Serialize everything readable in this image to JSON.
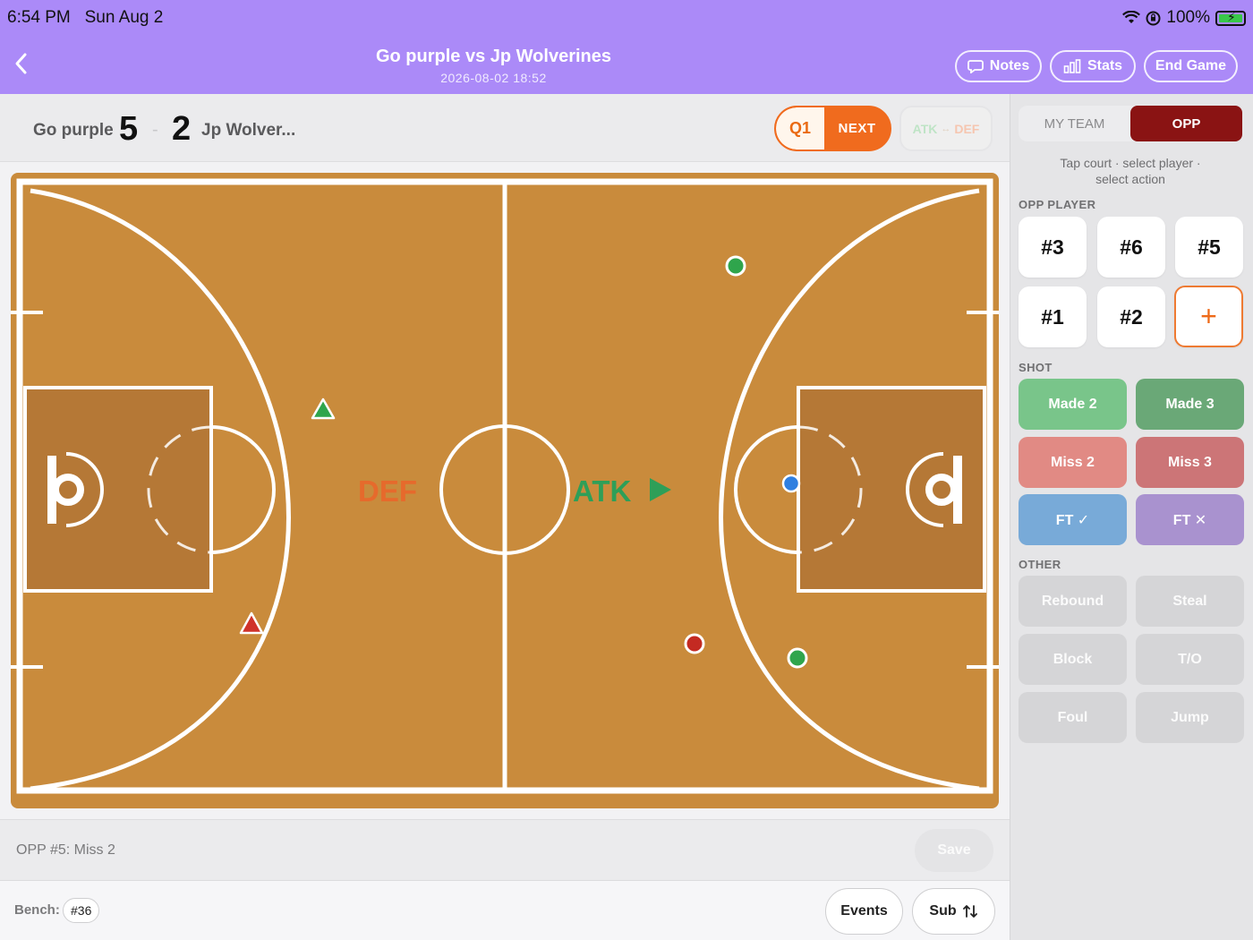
{
  "status": {
    "time": "6:54 PM",
    "date": "Sun Aug 2",
    "battery": "100%"
  },
  "header": {
    "title": "Go purple vs Jp Wolverines",
    "subtitle": "2026-08-02 18:52",
    "buttons": {
      "notes": "Notes",
      "stats": "Stats",
      "end_game": "End Game"
    }
  },
  "scoreboard": {
    "home_name": "Go purple",
    "home_score": "5",
    "separator": "-",
    "away_name": "Jp Wolver...",
    "away_score": "2",
    "quarter": "Q1",
    "next": "NEXT",
    "toggle": {
      "atk": "ATK",
      "arrow": "↔",
      "def": "DEF"
    }
  },
  "court": {
    "def_label": "DEF",
    "atk_label": "ATK",
    "colors": {
      "floor": "#c98b3c",
      "paint": "#b57836",
      "lines": "#ffffff",
      "def": "#e66a2c",
      "atk": "#2e9f58"
    }
  },
  "log": {
    "text": "OPP #5: Miss 2",
    "save": "Save"
  },
  "bench": {
    "label": "Bench:",
    "players": [
      "#36"
    ],
    "events": "Events",
    "sub": "Sub"
  },
  "panel": {
    "tabs": {
      "my_team": "MY TEAM",
      "opp": "OPP"
    },
    "hint_line1": "Tap court · select player ·",
    "hint_line2": "select action",
    "opp_player_label": "OPP PLAYER",
    "players": [
      "#3",
      "#6",
      "#5",
      "#1",
      "#2"
    ],
    "add": "+",
    "shot_label": "SHOT",
    "shots": {
      "made2": "Made 2",
      "made3": "Made 3",
      "miss2": "Miss 2",
      "miss3": "Miss 3",
      "ft_made": "FT ✓",
      "ft_miss": "FT ✕"
    },
    "other_label": "OTHER",
    "other": {
      "rebound": "Rebound",
      "steal": "Steal",
      "block": "Block",
      "turnover": "T/O",
      "foul": "Foul",
      "jump": "Jump"
    }
  }
}
